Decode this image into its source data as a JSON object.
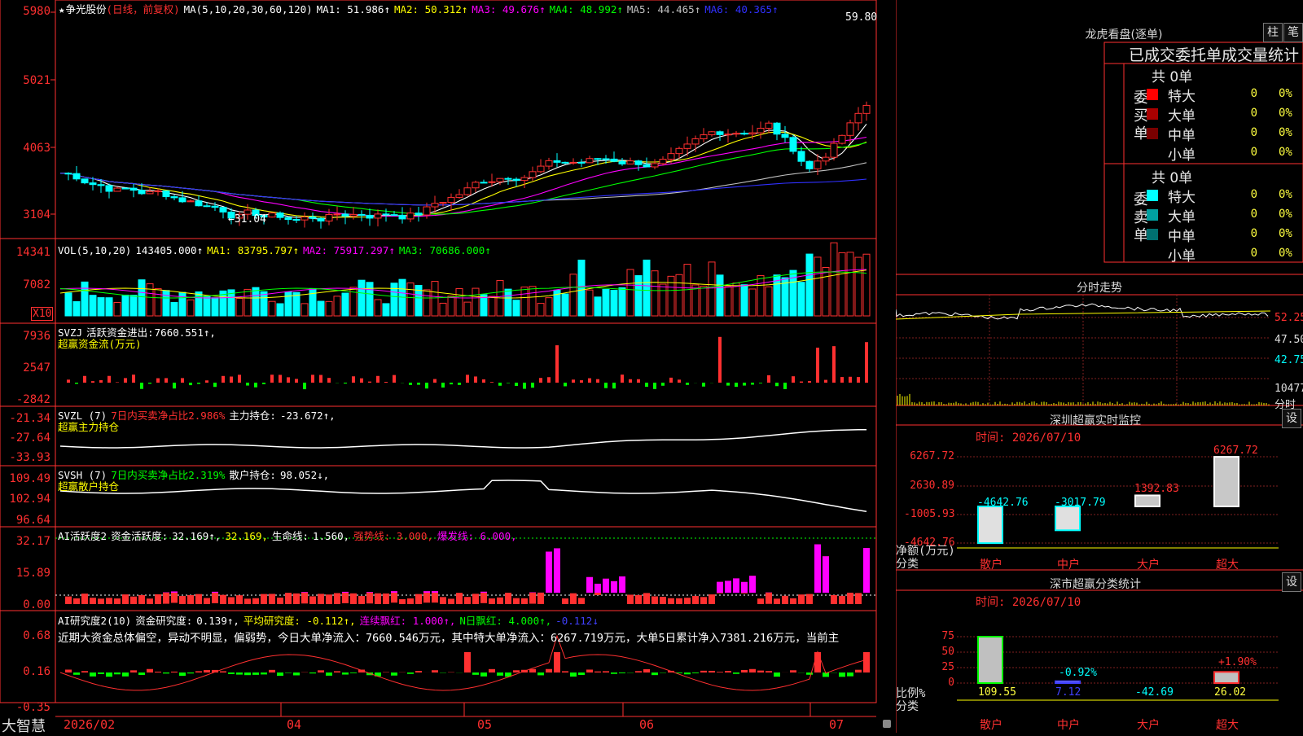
{
  "app": {
    "brand": "大智慧"
  },
  "main": {
    "title": "争光股份",
    "mode": "(日线，前复权)",
    "ma_label": "MA(5,10,20,30,60,120)",
    "ma": [
      {
        "label": "MA1:",
        "value": "51.986↑",
        "color": "#ffffff"
      },
      {
        "label": "MA2:",
        "value": "50.312↑",
        "color": "#ffff00"
      },
      {
        "label": "MA3:",
        "value": "49.676↑",
        "color": "#ff00ff"
      },
      {
        "label": "MA4:",
        "value": "48.992↑",
        "color": "#00ff00"
      },
      {
        "label": "MA5:",
        "value": "44.465↑",
        "color": "#c0c0c0"
      },
      {
        "label": "MA6:",
        "value": "40.365↑",
        "color": "#3030ff"
      }
    ],
    "yticks": [
      "5980",
      "5021",
      "4063",
      "3104"
    ],
    "high_label": "59.80",
    "low_label": "←31.04"
  },
  "vol": {
    "label": "VOL(5,10,20)",
    "value": "143405.000↑",
    "ma": [
      {
        "label": "MA1:",
        "value": "83795.797↑",
        "color": "#ffff00"
      },
      {
        "label": "MA2:",
        "value": "75917.297↑",
        "color": "#ff00ff"
      },
      {
        "label": "MA3:",
        "value": "70686.000↑",
        "color": "#00ff00"
      }
    ],
    "yticks": [
      "14341",
      "7082"
    ],
    "unit": "X10"
  },
  "svzj": {
    "label": "SVZJ",
    "desc": "活跃资金进出:",
    "value": "7660.551↑,",
    "sub": "超赢资金流(万元)",
    "yticks": [
      "7936",
      "2547",
      "-2842"
    ]
  },
  "svzl": {
    "label": "SVZL (7)",
    "desc1": "7日内买卖净占比2.986%",
    "desc2": "主力持仓:",
    "value": "-23.672↑,",
    "sub": "超赢主力持仓",
    "yticks": [
      "-21.34",
      "-27.64",
      "-33.93"
    ]
  },
  "svsh": {
    "label": "SVSH (7)",
    "desc1": "7日内买卖净占比2.319%",
    "desc2": "散户持仓:",
    "value": "98.052↓,",
    "sub": "超赢散户持仓",
    "yticks": [
      "109.49",
      "102.94",
      "96.64"
    ]
  },
  "ai1": {
    "label": "AI活跃度2",
    "desc": "资金活跃度:",
    "v1": "32.169↑,",
    "v2": "32.169,",
    "life_label": "生命线:",
    "life": "1.560,",
    "strong": "强势线: 3.000,",
    "burst": "爆发线: 6.000,",
    "yticks": [
      "32.17",
      "15.89",
      "0.00"
    ]
  },
  "ai2": {
    "label": "AI研究度2(10)",
    "desc": "资金研究度:",
    "v1": "0.139↑,",
    "avg": "平均研究度: -0.112↑,",
    "red": "连续飘红: 1.000↑,",
    "nred": "N日飘红: 4.000↑,",
    "last": "-0.112↓",
    "comment": "近期大资金总体偏空，异动不明显，偏弱势，今日大单净流入：7660.546万元，其中特大单净流入：6267.719万元，大单5日累计净入7381.216万元，当前主",
    "yticks": [
      "0.68",
      "0.16",
      "-0.35"
    ]
  },
  "xaxis": {
    "labels": [
      "2026/02",
      "04",
      "05",
      "06",
      "07"
    ]
  },
  "dragon": {
    "title": "龙虎看盘(逐单)",
    "btn1": "柱",
    "btn2": "笔",
    "header": "已成交委托单成交量统计",
    "buy_label": "委买单",
    "sell_label": "委卖单",
    "buy_total": "共 0单",
    "sell_total": "共 0单",
    "rows": [
      {
        "name": "特大",
        "count": "0",
        "pct": "0%"
      },
      {
        "name": "大单",
        "count": "0",
        "pct": "0%"
      },
      {
        "name": "中单",
        "count": "0",
        "pct": "0%"
      },
      {
        "name": "小单",
        "count": "0",
        "pct": "0%"
      }
    ],
    "colors_buy": [
      "#ff0000",
      "#aa0000",
      "#7a0000"
    ],
    "colors_sell": [
      "#00ffff",
      "#00a0a0",
      "#007070"
    ]
  },
  "fenshi": {
    "title": "分时走势",
    "yticks": [
      "52.25",
      "47.50",
      "42.75"
    ],
    "vol_label": "10477",
    "vol_unit": "分时"
  },
  "monitor": {
    "title": "深圳超赢实时监控",
    "btn": "设",
    "time": "时间: 2026/07/10",
    "yticks": [
      "6267.72",
      "2630.89",
      "-1005.93",
      "-4642.76"
    ],
    "labels": [
      "-4642.76",
      "-3017.79",
      "1392.83",
      "6267.72"
    ],
    "values": [
      -4642.76,
      -3017.79,
      1392.83,
      6267.72
    ],
    "categories": [
      "散户",
      "中户",
      "大户",
      "超大"
    ],
    "axis_label1": "净额(万元)",
    "axis_label2": "分类"
  },
  "classify": {
    "title": "深市超赢分类统计",
    "btn": "设",
    "time": "时间: 2026/07/10",
    "yticks": [
      "75",
      "50",
      "25",
      "0"
    ],
    "bar_labels": [
      "-0.92%",
      "+1.90%"
    ],
    "bottom_vals": [
      "109.55",
      "7.12",
      "-42.69",
      "26.02"
    ],
    "values": [
      75,
      3,
      0,
      18
    ],
    "categories": [
      "散户",
      "中户",
      "大户",
      "超大"
    ],
    "axis_label1": "比例%",
    "axis_label2": "分类"
  }
}
